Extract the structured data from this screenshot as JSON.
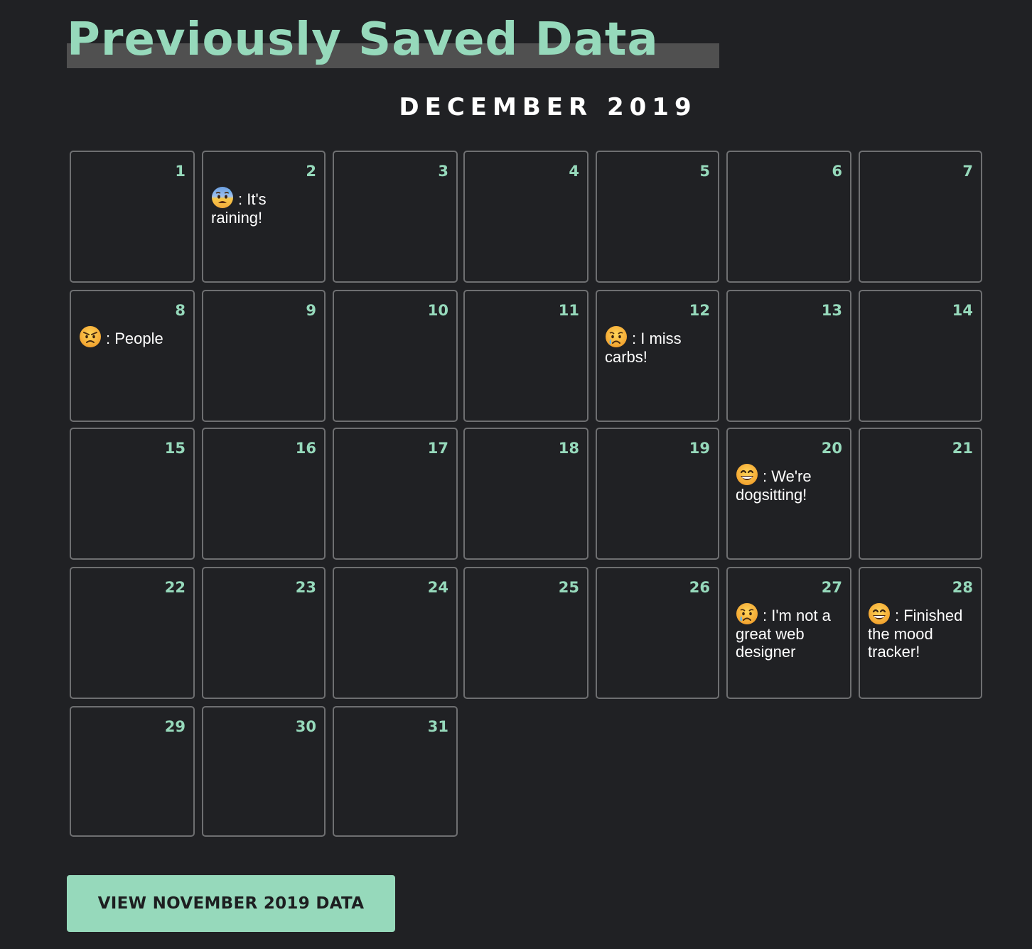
{
  "page": {
    "title": "Previously Saved Data",
    "month_heading": "DECEMBER 2019"
  },
  "calendar": {
    "days": [
      {
        "day": "1"
      },
      {
        "day": "2",
        "mood_icon": "anxious-sweat-emoji-icon",
        "note": ": It's raining!"
      },
      {
        "day": "3"
      },
      {
        "day": "4"
      },
      {
        "day": "5"
      },
      {
        "day": "6"
      },
      {
        "day": "7"
      },
      {
        "day": "8",
        "mood_icon": "angry-face-emoji-icon",
        "note": ": People"
      },
      {
        "day": "9"
      },
      {
        "day": "10"
      },
      {
        "day": "11"
      },
      {
        "day": "12",
        "mood_icon": "crying-face-emoji-icon",
        "note": ": I miss carbs!"
      },
      {
        "day": "13"
      },
      {
        "day": "14"
      },
      {
        "day": "15"
      },
      {
        "day": "16"
      },
      {
        "day": "17"
      },
      {
        "day": "18"
      },
      {
        "day": "19"
      },
      {
        "day": "20",
        "mood_icon": "grinning-face-emoji-icon",
        "note": ": We're dogsitting!"
      },
      {
        "day": "21"
      },
      {
        "day": "22"
      },
      {
        "day": "23"
      },
      {
        "day": "24"
      },
      {
        "day": "25"
      },
      {
        "day": "26"
      },
      {
        "day": "27",
        "mood_icon": "crying-face-emoji-icon",
        "note": ": I'm not a great web designer"
      },
      {
        "day": "28",
        "mood_icon": "grinning-face-emoji-icon",
        "note": ": Finished the mood tracker!"
      },
      {
        "day": "29"
      },
      {
        "day": "30"
      },
      {
        "day": "31"
      }
    ]
  },
  "footer": {
    "previous_month_button": "VIEW NOVEMBER 2019 DATA"
  },
  "colors": {
    "background": "#202124",
    "accent": "#96d9bb",
    "cell_border": "#6e6f71",
    "title_bar": "#505050"
  }
}
